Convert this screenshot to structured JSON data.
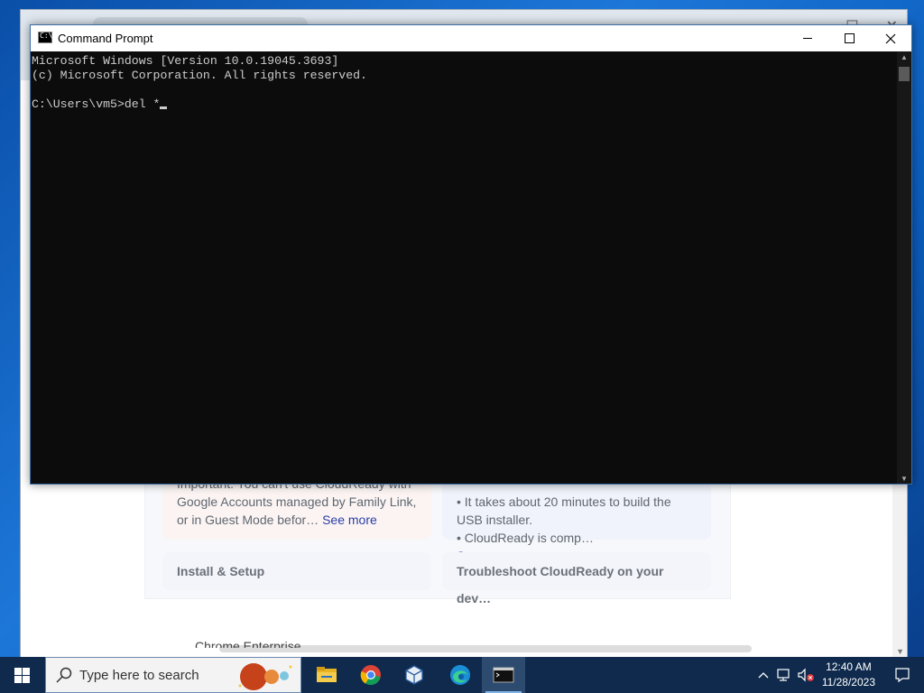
{
  "cmd": {
    "title": "Command Prompt",
    "icon_text": "C:\\",
    "lines": [
      "Microsoft Windows [Version 10.0.19045.3693]",
      "(c) Microsoft Corporation. All rights reserved.",
      "",
      "C:\\Users\\vm5>del *"
    ]
  },
  "background_page": {
    "card_a_text": "Important: You can't use CloudReady with Google Accounts managed by Family Link, or in Guest Mode befor…",
    "card_a_more": "See more",
    "card_b_text": "• It takes about 20 minutes to build the USB installer.\n• CloudReady is comp…",
    "card_b_more": "See more",
    "card_c_title": "Install & Setup",
    "card_d_title": "Troubleshoot CloudReady on your dev…",
    "footer_text": "Chrome Enterprise"
  },
  "taskbar": {
    "search_placeholder": "Type here to search",
    "clock_time": "12:40 AM",
    "clock_date": "11/28/2023"
  },
  "colors": {
    "taskbar": "#0f2a4d",
    "console_bg": "#0c0c0c",
    "console_text": "#cccccc"
  }
}
